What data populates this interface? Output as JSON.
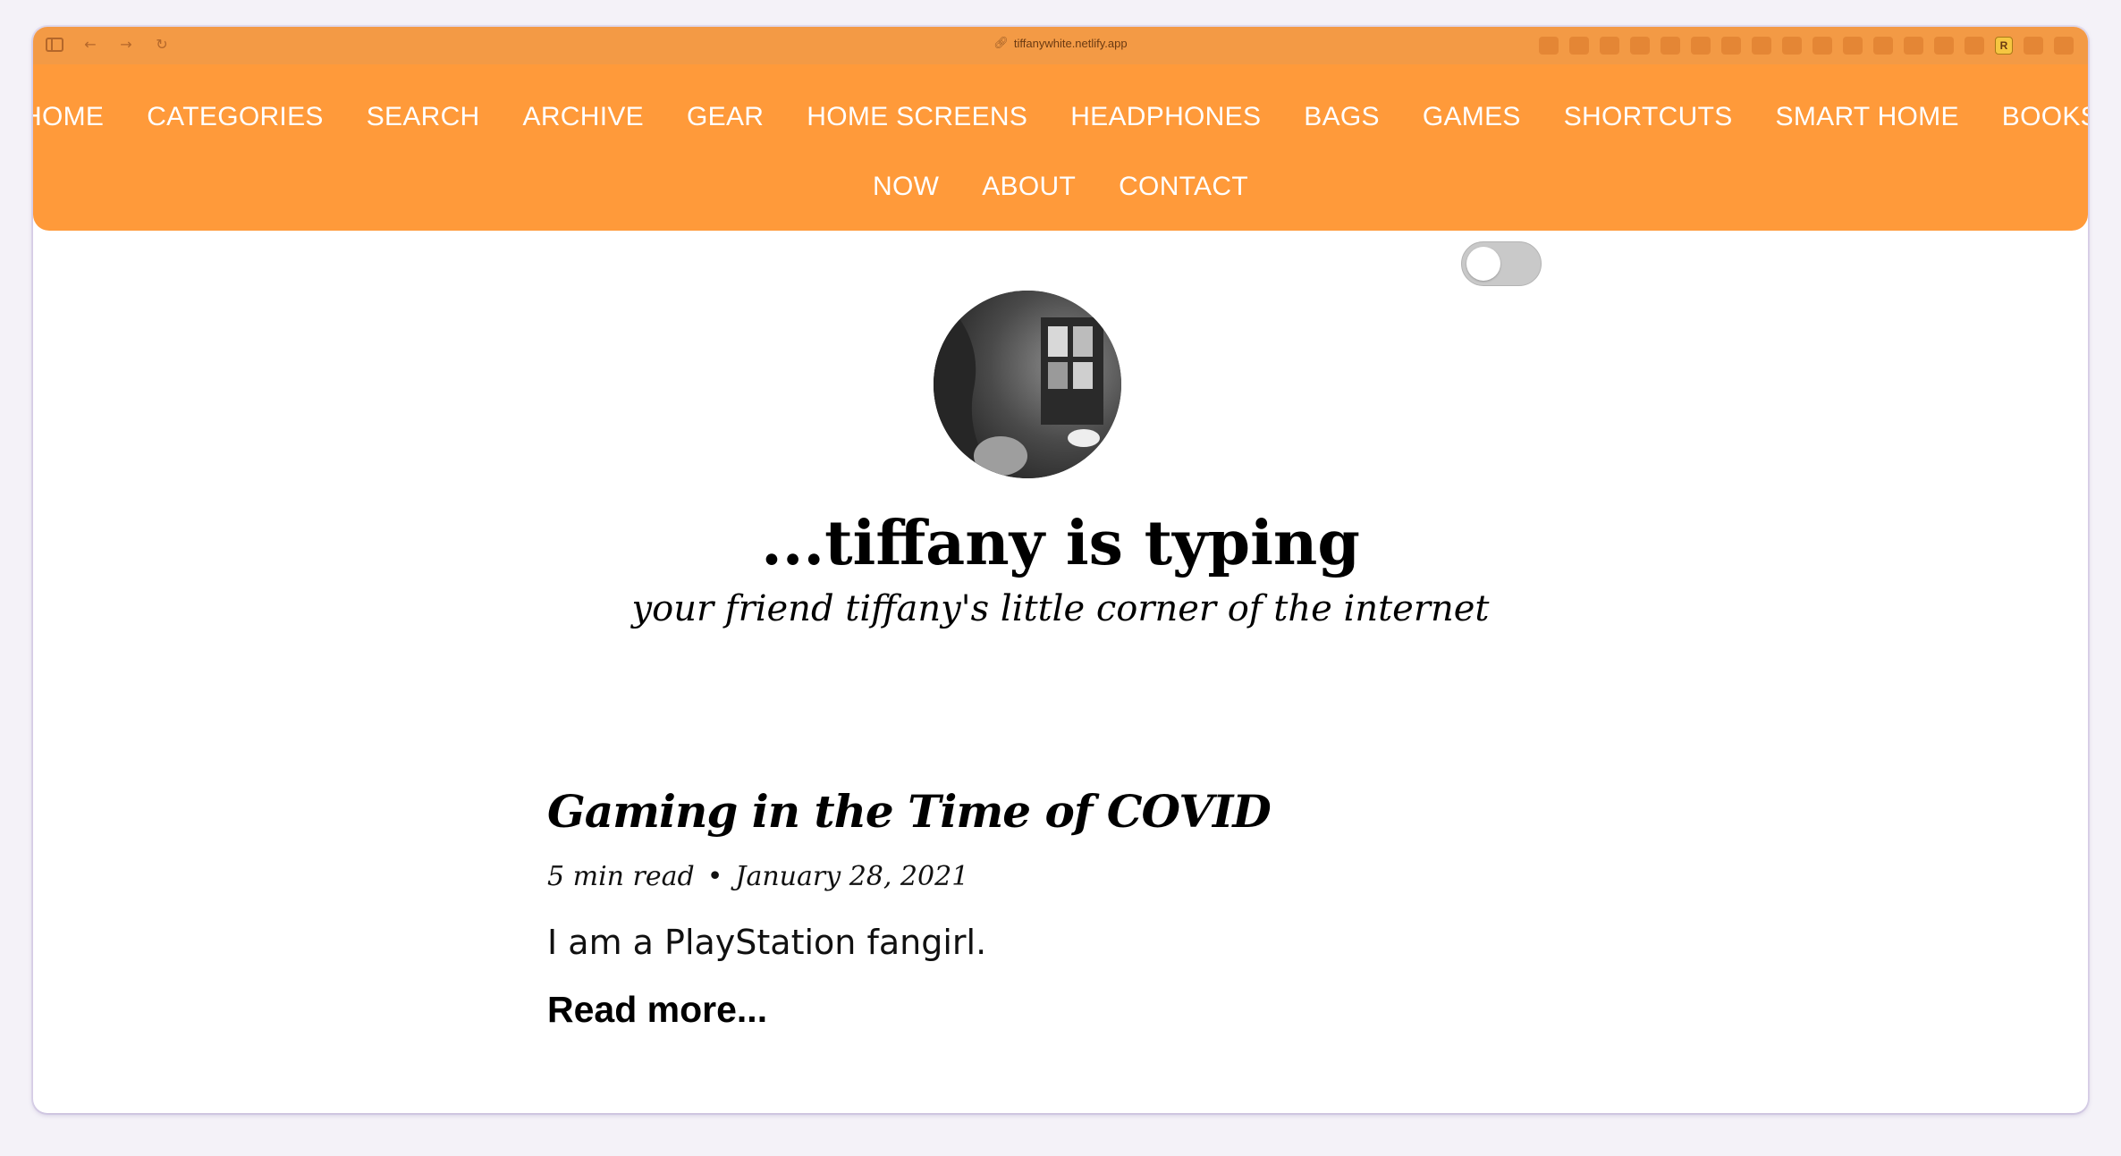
{
  "browser": {
    "url": "tiffanywhite.netlify.app",
    "extensions": [
      "extension-1-icon",
      "extension-2-icon",
      "extension-3-icon",
      "extension-4-icon",
      "extension-5-icon",
      "extension-6-icon",
      "extension-7-icon",
      "extension-8-icon",
      "extension-9-icon",
      "extension-10-icon",
      "extension-11-icon",
      "extension-12-icon",
      "extension-13-icon",
      "extension-14-icon",
      "extension-15-icon",
      "extension-16-icon",
      "extension-17-icon",
      "extension-18-icon"
    ],
    "r_extension_label": "R"
  },
  "nav": {
    "row1": [
      "HOME",
      "CATEGORIES",
      "SEARCH",
      "ARCHIVE",
      "GEAR",
      "HOME SCREENS",
      "HEADPHONES",
      "BAGS",
      "GAMES",
      "SHORTCUTS",
      "SMART HOME",
      "BOOKS"
    ],
    "row2": [
      "NOW",
      "ABOUT",
      "CONTACT"
    ]
  },
  "theme": {
    "accent": "#ff9a3a",
    "text": "#000000",
    "toggle_off": "#c9c9c9"
  },
  "theme_toggle": {
    "state": "off"
  },
  "header": {
    "title": "...tiffany is typing",
    "tagline": "your friend tiffany's little corner of the internet"
  },
  "post": {
    "title": "Gaming in the Time of COVID",
    "read_time": "5 min read",
    "separator": "•",
    "date": "January 28, 2021",
    "excerpt": "I am a PlayStation fangirl.",
    "read_more": "Read more..."
  }
}
